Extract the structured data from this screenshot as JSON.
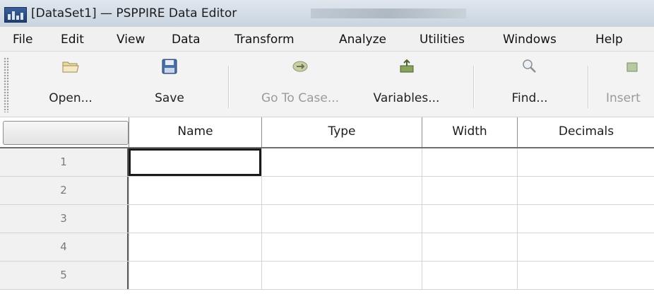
{
  "window": {
    "title": "[DataSet1] — PSPPIRE Data Editor"
  },
  "menu": [
    "File",
    "Edit",
    "View",
    "Data",
    "Transform",
    "Analyze",
    "Utilities",
    "Windows",
    "Help"
  ],
  "toolbar": {
    "open": "Open...",
    "save": "Save",
    "goto_case": "Go To Case...",
    "variables": "Variables...",
    "find": "Find...",
    "insert": "Insert"
  },
  "grid": {
    "columns": [
      "Name",
      "Type",
      "Width",
      "Decimals"
    ],
    "rows": [
      "1",
      "2",
      "3",
      "4",
      "5"
    ]
  }
}
